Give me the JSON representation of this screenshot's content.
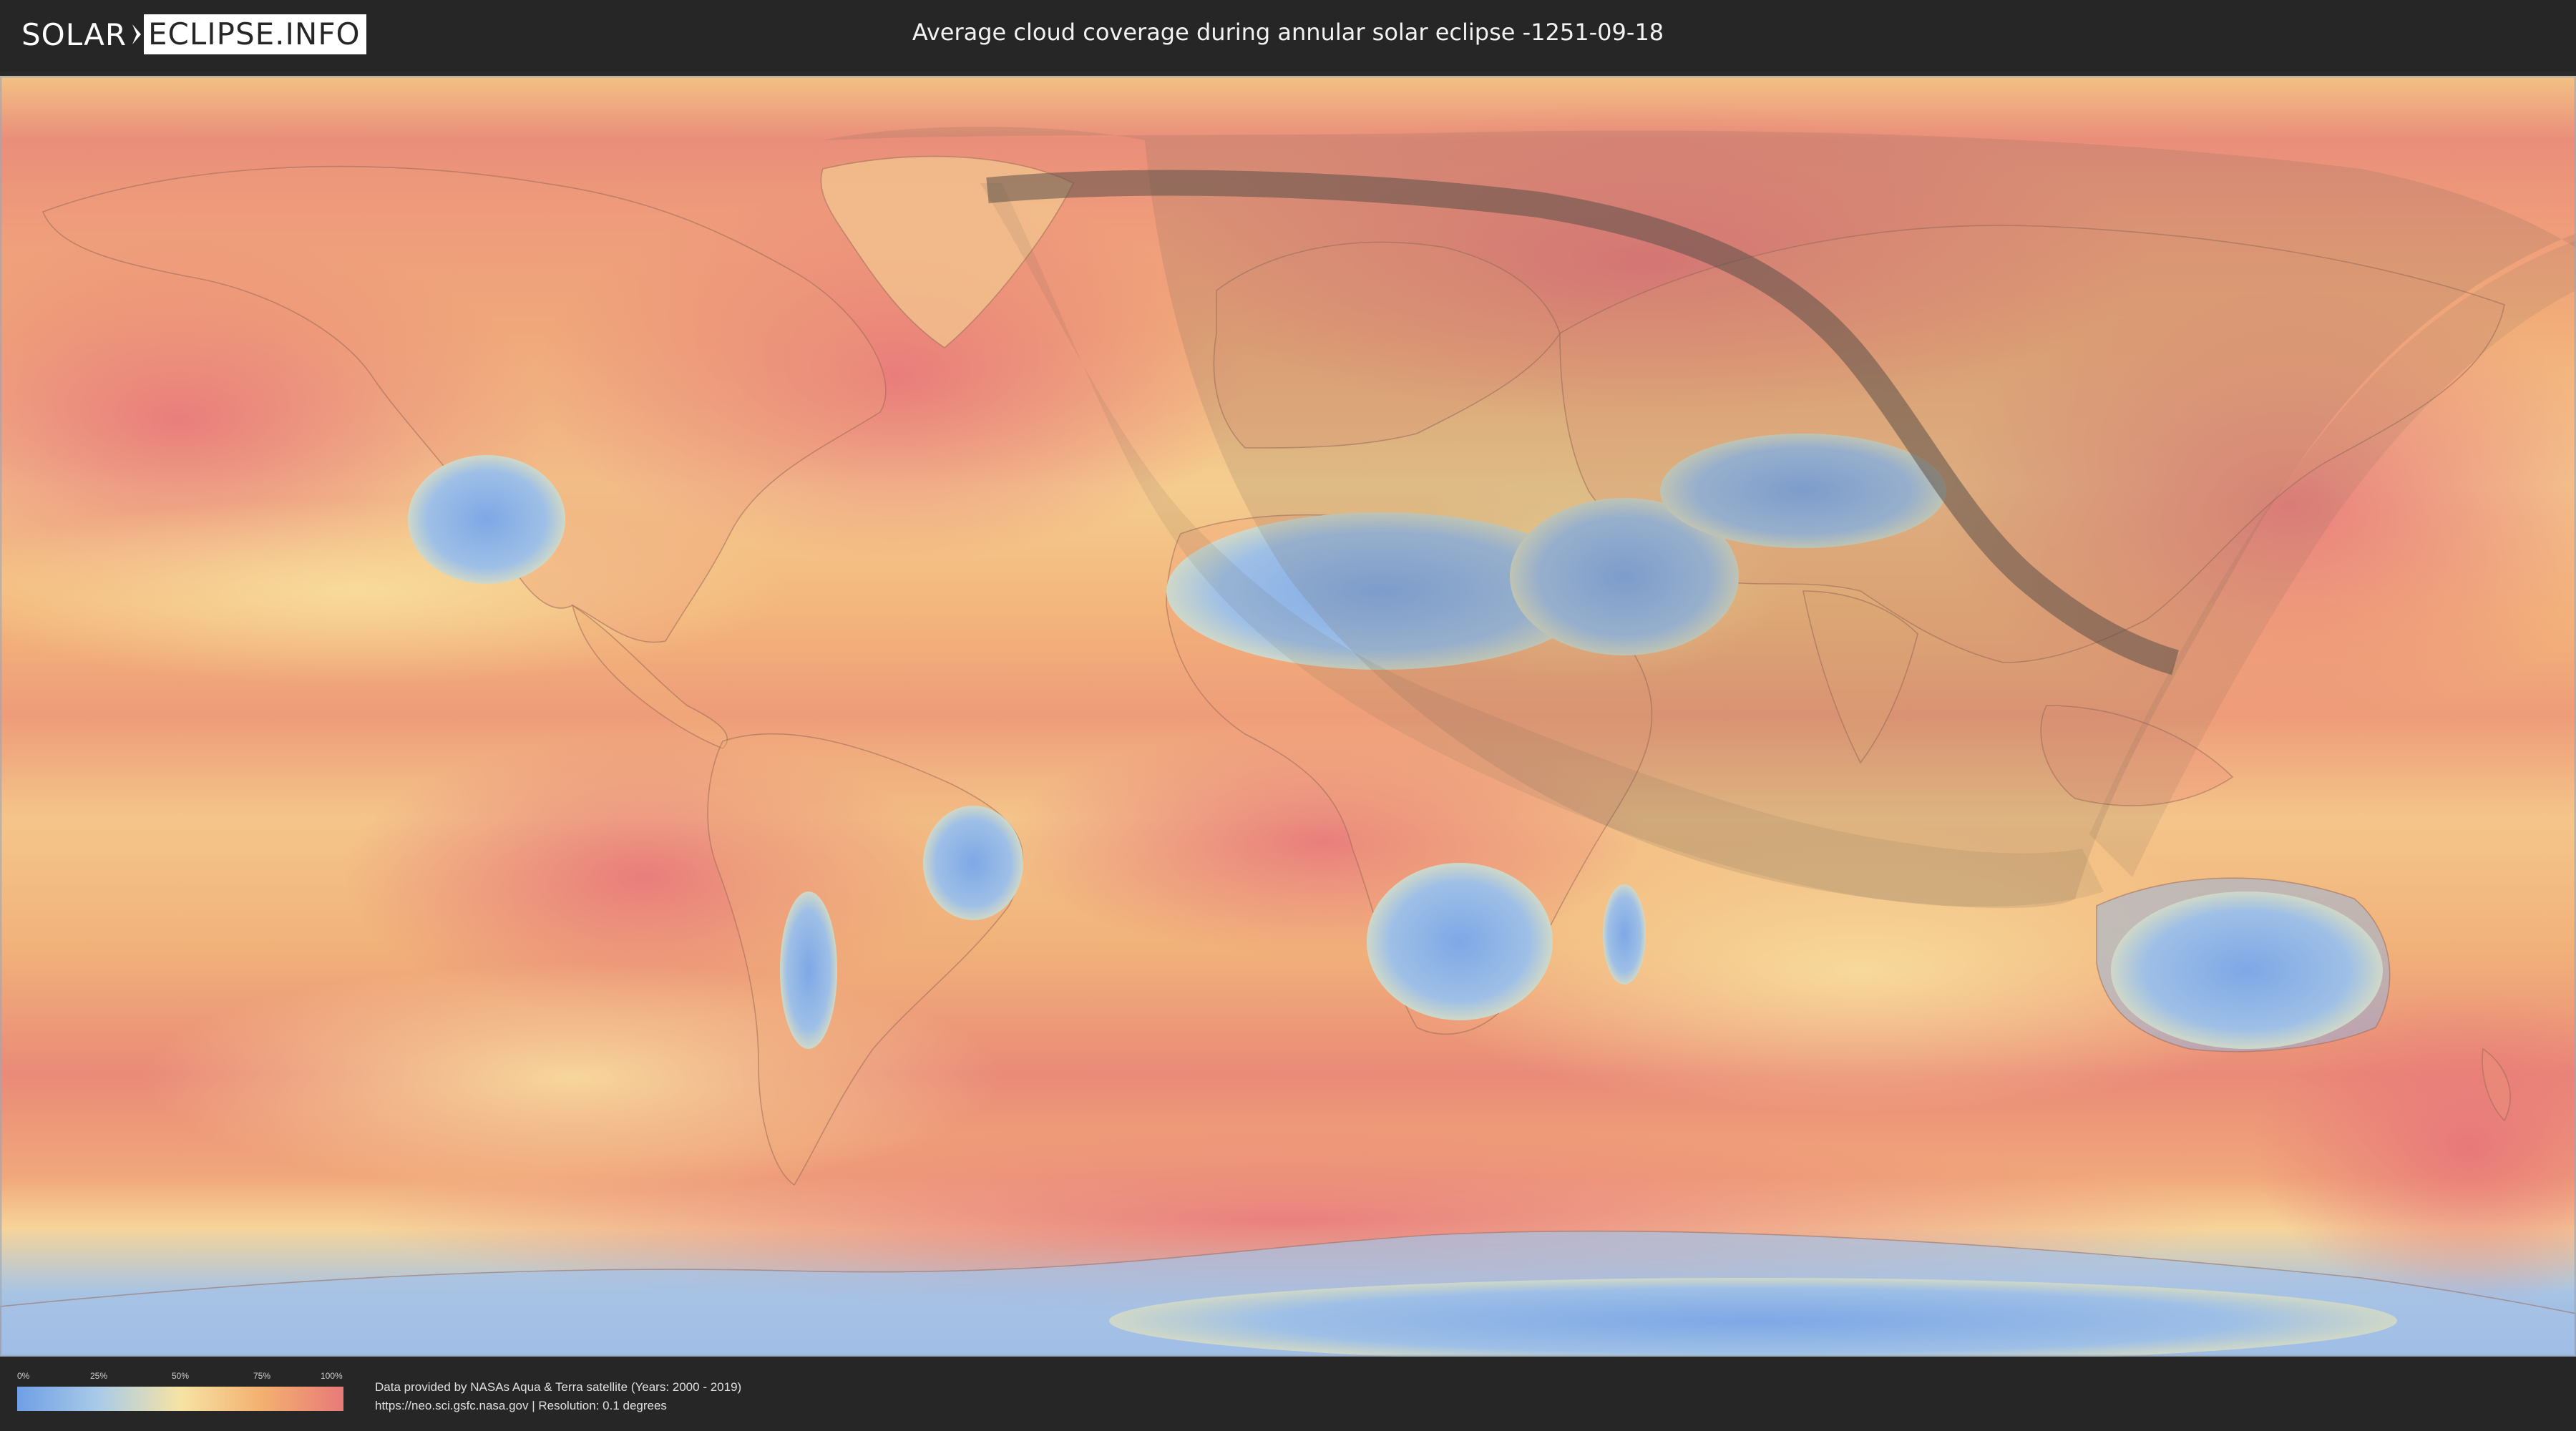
{
  "header": {
    "logo_part1": "SOLAR",
    "logo_part2": "ECLIPSE.INFO",
    "title": "Average cloud coverage during annular solar eclipse -1251-09-18"
  },
  "legend": {
    "ticks": [
      "0%",
      "25%",
      "50%",
      "75%",
      "100%"
    ],
    "colors": [
      "#6f9fe6",
      "#a9cbe8",
      "#f6e3a4",
      "#f3b06f",
      "#e97a78"
    ]
  },
  "footer": {
    "credit_line1": "Data provided by NASAs Aqua & Terra satellite (Years: 2000 - 2019)",
    "credit_line2": "https://neo.sci.gsfc.nasa.gov | Resolution: 0.1 degrees"
  },
  "map": {
    "projection": "equirectangular",
    "layer": "average cloud coverage",
    "overlay": "eclipse visibility region and central path"
  }
}
